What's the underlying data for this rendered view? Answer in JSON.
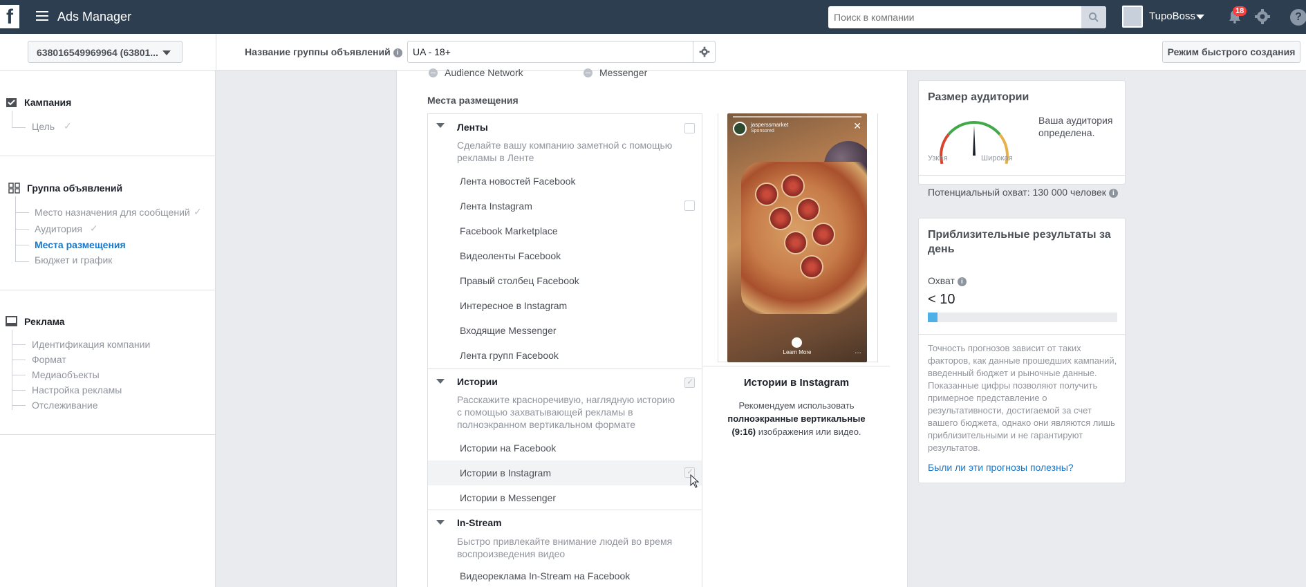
{
  "topbar": {
    "logo": "f",
    "app_title": "Ads Manager",
    "search_placeholder": "Поиск в компании",
    "account_name": "TupoBoss",
    "notifications_count": "18"
  },
  "subheader": {
    "account_id": "638016549969964 (63801...",
    "adset_name_label": "Название группы объявлений",
    "adset_name_value": "UA - 18+",
    "quick_create_label": "Режим быстрого создания"
  },
  "leftnav": {
    "campaign": {
      "title": "Кампания",
      "items": [
        "Цель"
      ]
    },
    "adset": {
      "title": "Группа объявлений",
      "items": [
        "Место назначения для сообщений",
        "Аудитория",
        "Места размещения",
        "Бюджет и график"
      ],
      "active": "Места размещения"
    },
    "ad": {
      "title": "Реклама",
      "items": [
        "Идентификация компании",
        "Формат",
        "Медиаобъекты",
        "Настройка рекламы",
        "Отслеживание"
      ]
    }
  },
  "main": {
    "platforms": [
      "Audience Network",
      "Messenger"
    ],
    "placements_title": "Места размещения",
    "groups": [
      {
        "title": "Ленты",
        "description": "Сделайте вашу компанию заметной с помощью рекламы в Ленте",
        "items": [
          "Лента новостей Facebook",
          "Лента Instagram",
          "Facebook Marketplace",
          "Видеоленты Facebook",
          "Правый столбец Facebook",
          "Интересное в Instagram",
          "Входящие Messenger",
          "Лента групп Facebook"
        ]
      },
      {
        "title": "Истории",
        "description": "Расскажите красноречивую, наглядную историю с помощью захватывающей рекламы в полноэкранном вертикальном формате",
        "items": [
          "Истории на Facebook",
          "Истории в Instagram",
          "Истории в Messenger"
        ]
      },
      {
        "title": "In-Stream",
        "description": "Быстро привлекайте внимание людей во время воспроизведения видео",
        "items": [
          "Видеореклама In-Stream на Facebook"
        ]
      }
    ],
    "preview": {
      "username": "jasperssmarket",
      "sponsored": "Sponsored",
      "cta": "Learn More",
      "title": "Истории в Instagram",
      "desc_pre": "Рекомендуем использовать",
      "desc_bold": "полноэкранные вертикальные (9:16)",
      "desc_post": "изображения или видео."
    }
  },
  "audience_card": {
    "title": "Размер аудитории",
    "narrow": "Узкая",
    "wide": "Широкая",
    "defined": "Ваша аудитория определена.",
    "reach": "Потенциальный охват: 130 000 человек",
    "gauge_colors": [
      "#d8442e",
      "#42a84a",
      "#e8b04a"
    ]
  },
  "results_card": {
    "title": "Приблизительные результаты за день",
    "reach_label": "Охват",
    "reach_value": "< 10",
    "reach_fraction": 0.05,
    "disclaimer": "Точность прогнозов зависит от таких факторов, как данные прошедших кампаний, введенный бюджет и рыночные данные. Показанные цифры позволяют получить примерное представление о результативности, достигаемой за счет вашего бюджета, однако они являются лишь приблизительными и не гарантируют результатов.",
    "feedback": "Были ли эти прогнозы полезны?"
  }
}
